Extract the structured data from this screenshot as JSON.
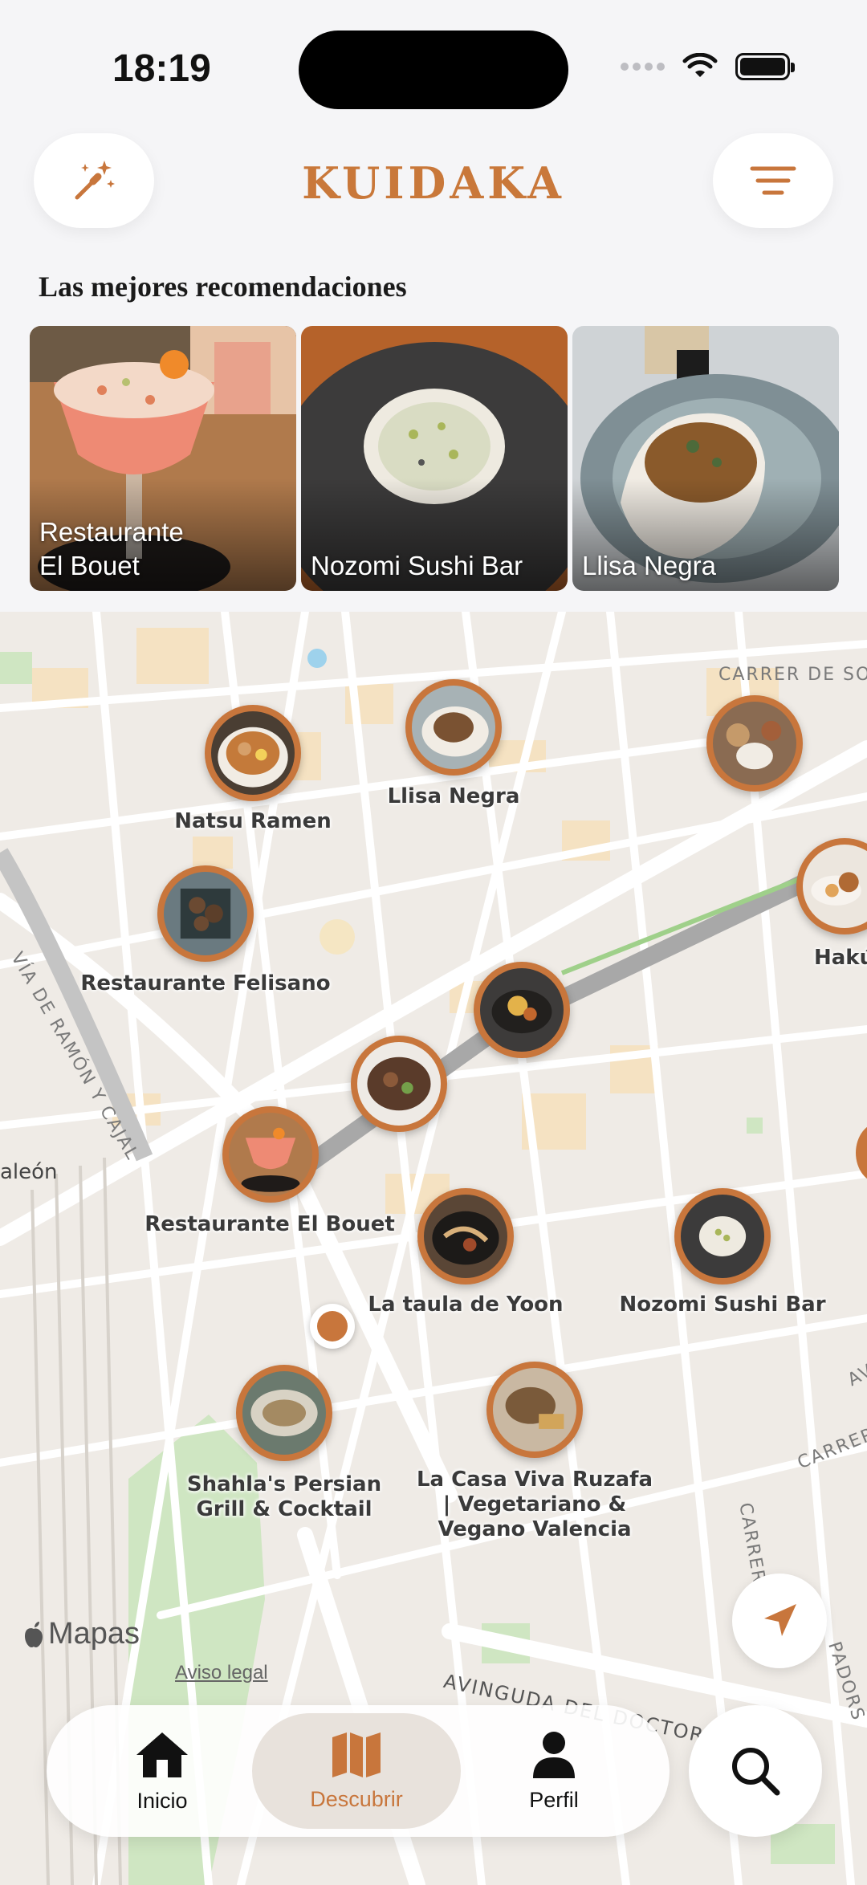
{
  "status_bar": {
    "time": "18:19"
  },
  "header": {
    "title": "KUIDAKA"
  },
  "recommendations": {
    "title": "Las mejores recomendaciones",
    "cards": [
      {
        "label_line1": "Restaurante",
        "label_line2": "El Bouet"
      },
      {
        "label_line1": "",
        "label_line2": "Nozomi Sushi Bar"
      },
      {
        "label_line1": "",
        "label_line2": "Llisa Negra"
      }
    ]
  },
  "map": {
    "pins": [
      {
        "label": "Natsu Ramen"
      },
      {
        "label": "Llisa Negra"
      },
      {
        "label": ""
      },
      {
        "label": "Hakú"
      },
      {
        "label": "Restaurante Felisano"
      },
      {
        "label": ""
      },
      {
        "label": ""
      },
      {
        "label": "Restaurante El Bouet"
      },
      {
        "label": "La taula de Yoon"
      },
      {
        "label": "Nozomi Sushi Bar"
      },
      {
        "label_line1": "Shahla's Persian",
        "label_line2": "Grill & Cocktail"
      },
      {
        "label_line1": "La Casa Viva Ruzafa",
        "label_line2": "| Vegetariano &",
        "label_line3": "Vegano Valencia"
      }
    ],
    "streets": {
      "s1": "CARRER DE SOR",
      "s2": "VÍA DE RAMÓN Y CAJAL",
      "s3": "aleón",
      "s4": "AVINGUDA DEL DOCTOR",
      "s5": "CARRER",
      "s6": "CARRER",
      "s7": "PADORS",
      "s8": "AV"
    },
    "attribution": "Mapas",
    "legal": "Aviso legal"
  },
  "tabbar": {
    "tabs": [
      {
        "label": "Inicio"
      },
      {
        "label": "Descubrir"
      },
      {
        "label": "Perfil"
      }
    ],
    "active": "Descubrir"
  },
  "colors": {
    "accent": "#c8763c",
    "background": "#f5f5f7"
  }
}
